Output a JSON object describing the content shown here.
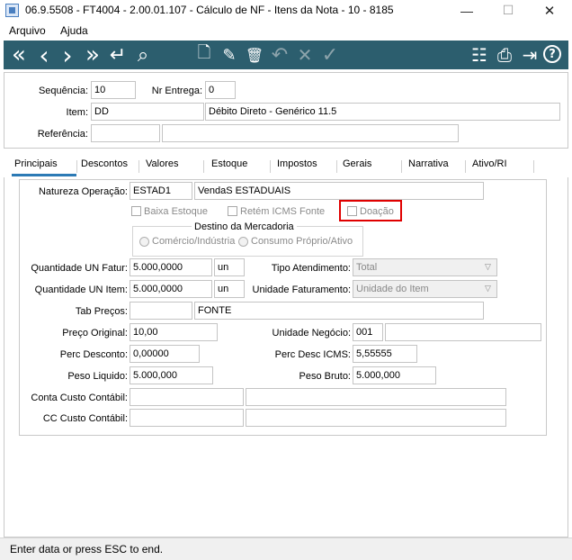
{
  "window": {
    "title": "06.9.5508 - FT4004 - 2.00.01.107 - Cálculo de NF - Itens da Nota - 10 - 8185",
    "minimize": "—",
    "maximize": "☐",
    "close": "✕"
  },
  "menu": [
    "Arquivo",
    "Ajuda"
  ],
  "toolbar": {
    "icons": {
      "first": "«",
      "prev": "‹",
      "next": "›",
      "last": "»",
      "goto": "↵",
      "search": "⌕",
      "new": "🗋",
      "edit": "✎",
      "delete": "🗑",
      "undo": "↶",
      "cancel": "✕",
      "confirm": "✓",
      "tree": "☷",
      "print": "⎙",
      "exit": "⇥",
      "help": "?"
    }
  },
  "header": {
    "sequencia_label": "Sequência:",
    "sequencia_value": "10",
    "nr_entrega_label": "Nr Entrega:",
    "nr_entrega_value": "0",
    "item_label": "Item:",
    "item_code": "DD",
    "item_desc": "Débito Direto - Genérico 11.5",
    "referencia_label": "Referência:",
    "referencia_value": "",
    "referencia_desc": ""
  },
  "tabs": [
    "Principais",
    "Descontos",
    "Valores",
    "Estoque",
    "Impostos",
    "Gerais",
    "Narrativa",
    "Ativo/RI"
  ],
  "form": {
    "natureza_label": "Natureza Operação:",
    "natureza_code": "ESTAD1",
    "natureza_desc": "VendaS ESTADUAIS",
    "baixa_estoque": "Baixa Estoque",
    "retem_icms": "Retém ICMS Fonte",
    "doacao": "Doação",
    "destino_title": "Destino da Mercadoria",
    "destino_opt1": "Comércio/Indústria",
    "destino_opt2": "Consumo Próprio/Ativo",
    "qtd_fatur_label": "Quantidade UN Fatur:",
    "qtd_fatur_value": "5.000,0000",
    "qtd_fatur_un": "un",
    "tipo_atend_label": "Tipo Atendimento:",
    "tipo_atend_value": "Total",
    "qtd_item_label": "Quantidade UN Item:",
    "qtd_item_value": "5.000,0000",
    "qtd_item_un": "un",
    "unid_fat_label": "Unidade Faturamento:",
    "unid_fat_value": "Unidade do Item",
    "tab_precos_label": "Tab Preços:",
    "tab_precos_code": "",
    "tab_precos_desc": "FONTE",
    "preco_orig_label": "Preço Original:",
    "preco_orig_value": "10,00",
    "unid_negocio_label": "Unidade Negócio:",
    "unid_negocio_code": "001",
    "unid_negocio_desc": "",
    "perc_desc_label": "Perc Desconto:",
    "perc_desc_value": "0,00000",
    "perc_desc_icms_label": "Perc Desc ICMS:",
    "perc_desc_icms_value": "5,55555",
    "peso_liq_label": "Peso Liquido:",
    "peso_liq_value": "5.000,000",
    "peso_bruto_label": "Peso Bruto:",
    "peso_bruto_value": "5.000,000",
    "conta_custo_label": "Conta Custo Contábil:",
    "cc_custo_label": "CC Custo Contábil:"
  },
  "status": "Enter data or press ESC to end.",
  "colors": {
    "toolbar_bg": "#2c5e6e",
    "tab_active": "#2c7ab5",
    "highlight": "#e00000"
  }
}
